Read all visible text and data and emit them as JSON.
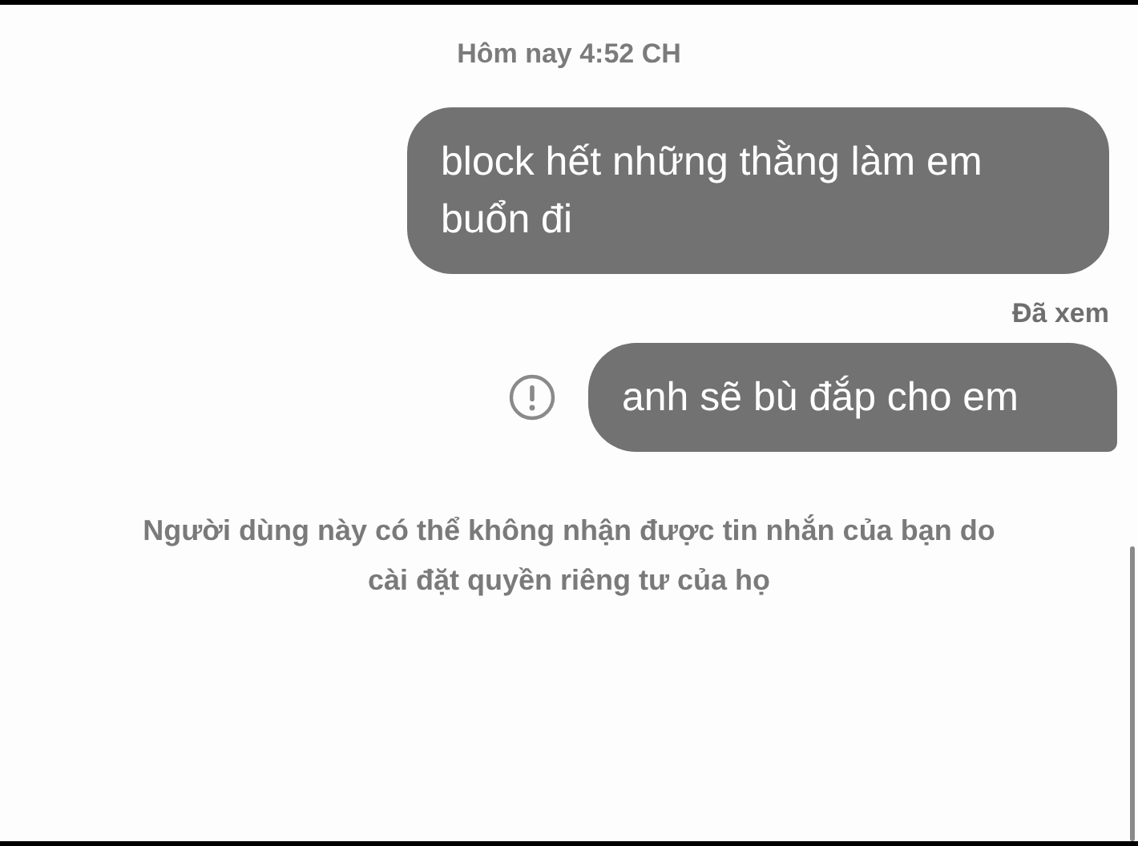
{
  "timestamp": "Hôm nay 4:52 CH",
  "messages": [
    {
      "text": "block hết những thằng làm em buổn đi",
      "status_after": "Đã xem",
      "failed": false
    },
    {
      "text": "anh sẽ bù đắp cho em",
      "failed": true
    }
  ],
  "notice": "Người dùng này có thể không nhận được tin nhắn của bạn do cài đặt quyền riêng tư của họ"
}
